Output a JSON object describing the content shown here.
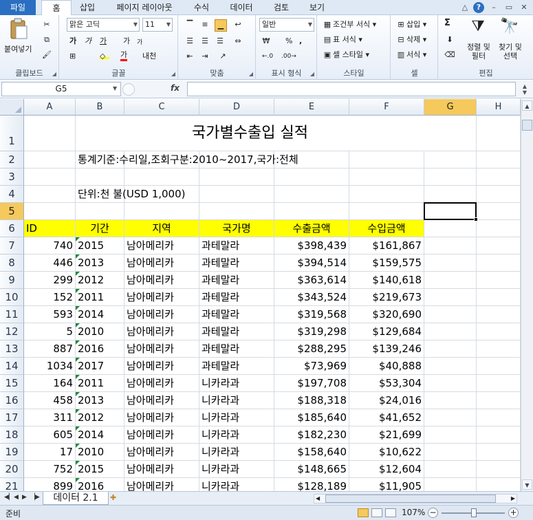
{
  "ribbon_tabs": [
    "파일",
    "홈",
    "삽입",
    "페이지 레이아웃",
    "수식",
    "데이터",
    "검토",
    "보기"
  ],
  "window_controls": {
    "minimize_ribbon": "△",
    "help": "?",
    "minimize": "–",
    "restore": "▭",
    "close": "✕"
  },
  "clipboard": {
    "paste": "붙여넣기",
    "label": "클립보드"
  },
  "font": {
    "name": "맑은 고딕",
    "size": "11",
    "bold": "가",
    "italic": "가",
    "underline": "가",
    "grow": "가",
    "shrink": "가",
    "border": "⊞",
    "fill_color": "#ffff00",
    "font_color": "#ff0000",
    "font_color_glyph": "가",
    "phonetic": "내천",
    "label": "글꼴"
  },
  "alignment": {
    "label": "맞춤"
  },
  "number": {
    "format": "일반",
    "percent": "%",
    "comma": ",",
    "label": "표시 형식"
  },
  "styles": {
    "conditional": "조건부 서식",
    "table": "표 서식",
    "cell": "셀 스타일",
    "label": "스타일"
  },
  "cells": {
    "insert": "삽입",
    "delete": "삭제",
    "format": "서식",
    "label": "셀"
  },
  "editing": {
    "sum": "Σ",
    "sort": "정렬 및 필터",
    "find": "찾기 및 선택",
    "label": "편집"
  },
  "formula_bar": {
    "name_box": "G5",
    "fx": "fx",
    "formula": ""
  },
  "columns": [
    "A",
    "B",
    "C",
    "D",
    "E",
    "F",
    "G",
    "H"
  ],
  "row_numbers": [
    "1",
    "2",
    "3",
    "4",
    "5",
    "6",
    "7",
    "8",
    "9",
    "10",
    "11",
    "12",
    "13",
    "14",
    "15",
    "16",
    "17",
    "18",
    "19",
    "20",
    "21"
  ],
  "sheet": {
    "title": "국가별수출입 실적",
    "criteria": "통계기준:수리일,조회구분:2010~2017,국가:전체",
    "unit": "단위:천 불(USD 1,000)",
    "headers": [
      "ID",
      "기간",
      "지역",
      "국가명",
      "수출금액",
      "수입금액"
    ],
    "header_fill": "#ffff00",
    "rows": [
      {
        "id": "740",
        "period": "2015",
        "region": "남아메리카",
        "country": "과테말라",
        "export": "$398,439",
        "import": "$161,867"
      },
      {
        "id": "446",
        "period": "2013",
        "region": "남아메리카",
        "country": "과테말라",
        "export": "$394,514",
        "import": "$159,575"
      },
      {
        "id": "299",
        "period": "2012",
        "region": "남아메리카",
        "country": "과테말라",
        "export": "$363,614",
        "import": "$140,618"
      },
      {
        "id": "152",
        "period": "2011",
        "region": "남아메리카",
        "country": "과테말라",
        "export": "$343,524",
        "import": "$219,673"
      },
      {
        "id": "593",
        "period": "2014",
        "region": "남아메리카",
        "country": "과테말라",
        "export": "$319,568",
        "import": "$320,690"
      },
      {
        "id": "5",
        "period": "2010",
        "region": "남아메리카",
        "country": "과테말라",
        "export": "$319,298",
        "import": "$129,684"
      },
      {
        "id": "887",
        "period": "2016",
        "region": "남아메리카",
        "country": "과테말라",
        "export": "$288,295",
        "import": "$139,246"
      },
      {
        "id": "1034",
        "period": "2017",
        "region": "남아메리카",
        "country": "과테말라",
        "export": "$73,969",
        "import": "$40,888"
      },
      {
        "id": "164",
        "period": "2011",
        "region": "남아메리카",
        "country": "니카라과",
        "export": "$197,708",
        "import": "$53,304"
      },
      {
        "id": "458",
        "period": "2013",
        "region": "남아메리카",
        "country": "니카라과",
        "export": "$188,318",
        "import": "$24,016"
      },
      {
        "id": "311",
        "period": "2012",
        "region": "남아메리카",
        "country": "니카라과",
        "export": "$185,640",
        "import": "$41,652"
      },
      {
        "id": "605",
        "period": "2014",
        "region": "남아메리카",
        "country": "니카라과",
        "export": "$182,230",
        "import": "$21,699"
      },
      {
        "id": "17",
        "period": "2010",
        "region": "남아메리카",
        "country": "니카라과",
        "export": "$158,640",
        "import": "$10,622"
      },
      {
        "id": "752",
        "period": "2015",
        "region": "남아메리카",
        "country": "니카라과",
        "export": "$148,665",
        "import": "$12,604"
      },
      {
        "id": "899",
        "period": "2016",
        "region": "남아메리카",
        "country": "니카라과",
        "export": "$128,189",
        "import": "$11,905"
      }
    ]
  },
  "sheet_tab": "데이터 2.1",
  "status": {
    "ready": "준비",
    "zoom": "107%",
    "zoom_minus": "−",
    "zoom_plus": "+"
  },
  "accent_color": "#2a6fc1",
  "selection_color": "#f5c95b"
}
